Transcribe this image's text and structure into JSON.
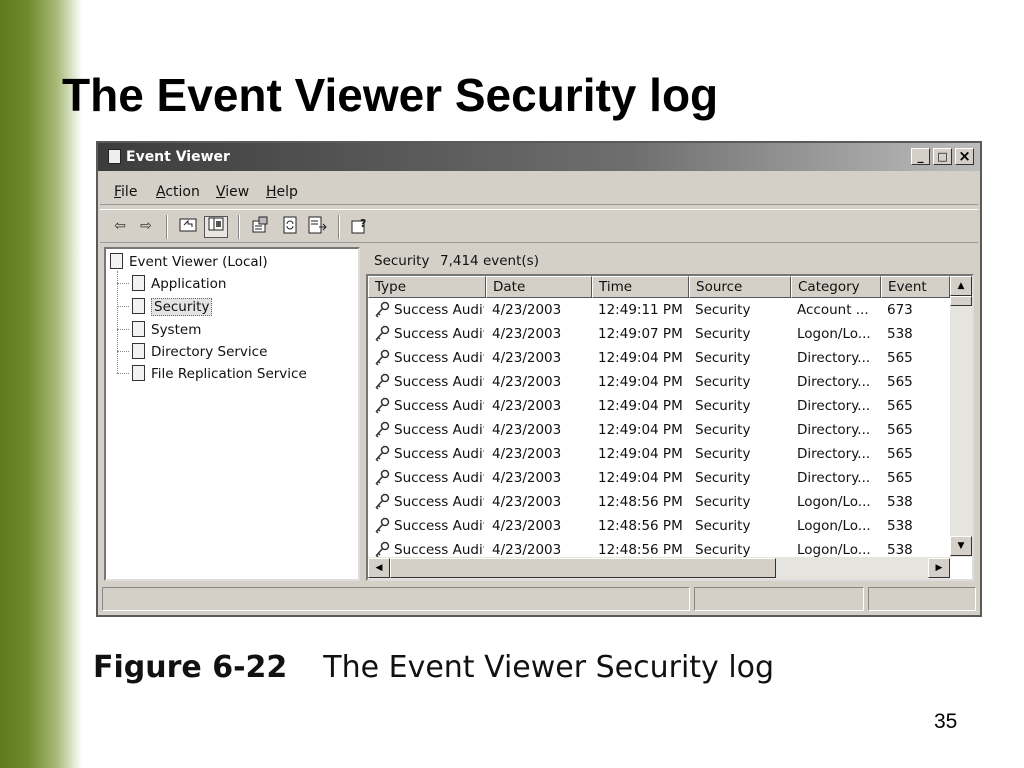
{
  "slide": {
    "title": "The Event Viewer Security log",
    "caption_number": "Figure 6-22",
    "caption_text": "The Event Viewer Security log",
    "page_number": "35",
    "accent_color": "#6f8c2c"
  },
  "window": {
    "title": "Event Viewer",
    "controls": {
      "minimize": "_",
      "maximize": "□",
      "close": "×"
    }
  },
  "menu": {
    "items": [
      {
        "label": "File",
        "mnemonic": "F",
        "rest": "ile"
      },
      {
        "label": "Action",
        "mnemonic": "A",
        "rest": "ction"
      },
      {
        "label": "View",
        "mnemonic": "V",
        "rest": "iew"
      },
      {
        "label": "Help",
        "mnemonic": "H",
        "rest": "elp"
      }
    ]
  },
  "toolbar": {
    "icons": [
      "back-arrow-icon",
      "forward-arrow-icon",
      "up-folder-icon",
      "show-hide-tree-icon",
      "properties-icon",
      "refresh-icon",
      "export-list-icon",
      "help-icon"
    ]
  },
  "tree": {
    "root": "Event Viewer (Local)",
    "items": [
      {
        "label": "Application",
        "selected": false
      },
      {
        "label": "Security",
        "selected": true
      },
      {
        "label": "System",
        "selected": false
      },
      {
        "label": "Directory Service",
        "selected": false
      },
      {
        "label": "File Replication Service",
        "selected": false
      }
    ]
  },
  "list": {
    "log_name": "Security",
    "event_count": "7,414 event(s)",
    "columns": [
      "Type",
      "Date",
      "Time",
      "Source",
      "Category",
      "Event"
    ],
    "rows": [
      [
        "Success Audit",
        "4/23/2003",
        "12:49:11 PM",
        "Security",
        "Account ...",
        "673"
      ],
      [
        "Success Audit",
        "4/23/2003",
        "12:49:07 PM",
        "Security",
        "Logon/Lo...",
        "538"
      ],
      [
        "Success Audit",
        "4/23/2003",
        "12:49:04 PM",
        "Security",
        "Directory...",
        "565"
      ],
      [
        "Success Audit",
        "4/23/2003",
        "12:49:04 PM",
        "Security",
        "Directory...",
        "565"
      ],
      [
        "Success Audit",
        "4/23/2003",
        "12:49:04 PM",
        "Security",
        "Directory...",
        "565"
      ],
      [
        "Success Audit",
        "4/23/2003",
        "12:49:04 PM",
        "Security",
        "Directory...",
        "565"
      ],
      [
        "Success Audit",
        "4/23/2003",
        "12:49:04 PM",
        "Security",
        "Directory...",
        "565"
      ],
      [
        "Success Audit",
        "4/23/2003",
        "12:49:04 PM",
        "Security",
        "Directory...",
        "565"
      ],
      [
        "Success Audit",
        "4/23/2003",
        "12:48:56 PM",
        "Security",
        "Logon/Lo...",
        "538"
      ],
      [
        "Success Audit",
        "4/23/2003",
        "12:48:56 PM",
        "Security",
        "Logon/Lo...",
        "538"
      ],
      [
        "Success Audit",
        "4/23/2003",
        "12:48:56 PM",
        "Security",
        "Logon/Lo...",
        "538"
      ]
    ]
  }
}
